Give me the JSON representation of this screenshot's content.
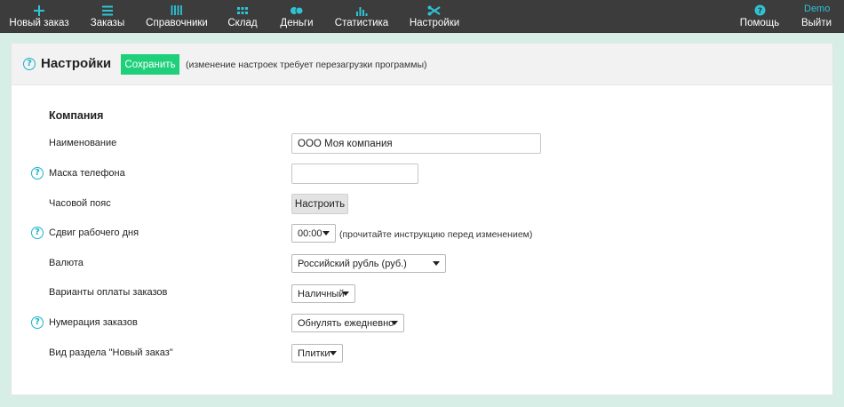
{
  "nav": {
    "items": [
      {
        "label": "Новый заказ",
        "icon": "plus-icon"
      },
      {
        "label": "Заказы",
        "icon": "list-icon"
      },
      {
        "label": "Справочники",
        "icon": "columns-icon"
      },
      {
        "label": "Склад",
        "icon": "grid-icon"
      },
      {
        "label": "Деньги",
        "icon": "coins-icon"
      },
      {
        "label": "Статистика",
        "icon": "bar-chart-icon"
      },
      {
        "label": "Настройки",
        "icon": "wrench-icon"
      }
    ],
    "help_label": "Помощь",
    "logout_label": "Выйти",
    "user": "Demo",
    "accent": "#2ec4d6"
  },
  "header": {
    "title": "Настройки",
    "save_label": "Сохранить",
    "hint": "(изменение настроек требует перезагрузки программы)",
    "save_color": "#1fd07a"
  },
  "company": {
    "section_title": "Компания",
    "name_label": "Наименование",
    "name_value": "ООО Моя компания",
    "phone_mask_label": "Маска телефона",
    "phone_mask_value": "",
    "timezone_label": "Часовой пояс",
    "timezone_button": "Настроить",
    "day_shift_label": "Сдвиг рабочего дня",
    "day_shift_value": "00:00",
    "day_shift_note": "(прочитайте инструкцию перед изменением)",
    "currency_label": "Валюта",
    "currency_value": "Российский рубль (руб.)",
    "payment_label": "Варианты оплаты заказов",
    "payment_value": "Наличный",
    "numbering_label": "Нумерация заказов",
    "numbering_value": "Обнулять ежедневно",
    "view_label": "Вид раздела \"Новый заказ\"",
    "view_value": "Плитки"
  }
}
